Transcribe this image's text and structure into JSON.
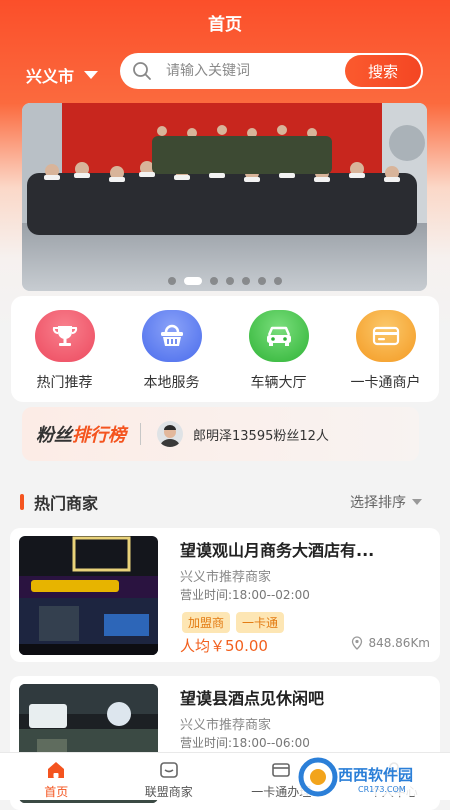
{
  "header": {
    "title": "首页"
  },
  "location": {
    "city": "兴义市"
  },
  "search": {
    "placeholder": "请输入关键词",
    "button": "搜索"
  },
  "banner": {
    "slide_count": 7,
    "active_index": 1
  },
  "categories": [
    {
      "label": "热门推荐",
      "icon": "trophy-icon",
      "color": "#f0566b"
    },
    {
      "label": "本地服务",
      "icon": "basket-icon",
      "color": "#5b7ff2"
    },
    {
      "label": "车辆大厅",
      "icon": "car-icon",
      "color": "#3ec244"
    },
    {
      "label": "一卡通商户",
      "icon": "card-icon",
      "color": "#f7a938"
    }
  ],
  "ranking": {
    "title_a": "粉丝",
    "title_b": "排行榜",
    "text": "郎明泽13595粉丝12人"
  },
  "section": {
    "title": "热门商家",
    "sort": "选择排序"
  },
  "shops": [
    {
      "name": "望谟观山月商务大酒店有...",
      "sub": "兴义市推荐商家",
      "hours": "营业时间:18:00--02:00",
      "tags": [
        "加盟商",
        "一卡通"
      ],
      "price": "人均￥50.00",
      "distance": "848.86Km"
    },
    {
      "name": "望谟县酒点见休闲吧",
      "sub": "兴义市推荐商家",
      "hours": "营业时间:18:00--06:00"
    }
  ],
  "tabs": [
    {
      "label": "首页",
      "icon": "home-icon",
      "active": true
    },
    {
      "label": "联盟商家",
      "icon": "alliance-icon",
      "active": false
    },
    {
      "label": "一卡通办理",
      "icon": "card-icon",
      "active": false
    },
    {
      "label": "个人中心",
      "icon": "user-icon",
      "active": false
    }
  ],
  "watermark": {
    "text": "西西软件园",
    "sub": "CR173.COM"
  },
  "colors": {
    "accent": "#f4541f",
    "header": "#fb4f2a"
  }
}
